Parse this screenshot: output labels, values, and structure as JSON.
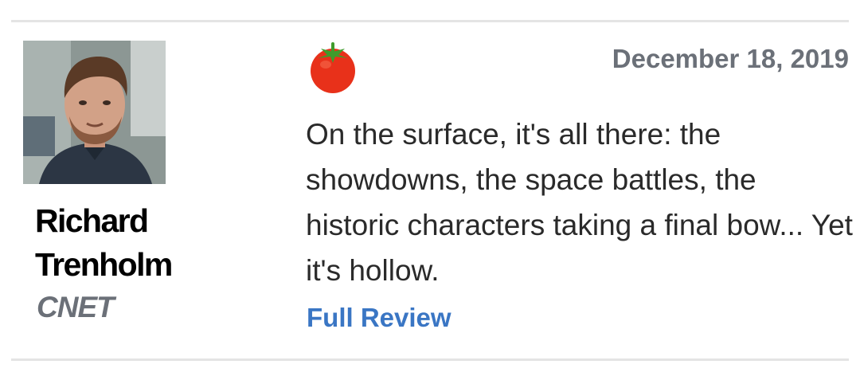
{
  "critic": {
    "name": "Richard Trenholm",
    "publication": "CNET",
    "avatar_alt": "critic-photo"
  },
  "review": {
    "rating_icon": "fresh-tomato-icon",
    "date": "December 18, 2019",
    "quote": "On the surface, it's all there: the showdowns, the space battles, the historic characters taking a final bow... Yet it's hollow.",
    "link_label": "Full Review"
  },
  "colors": {
    "tomato_red": "#e8311a",
    "stem_green": "#3f9b2c",
    "link_blue": "#3a76c4",
    "meta_gray": "#6b7078",
    "divider": "#e4e4e4"
  }
}
